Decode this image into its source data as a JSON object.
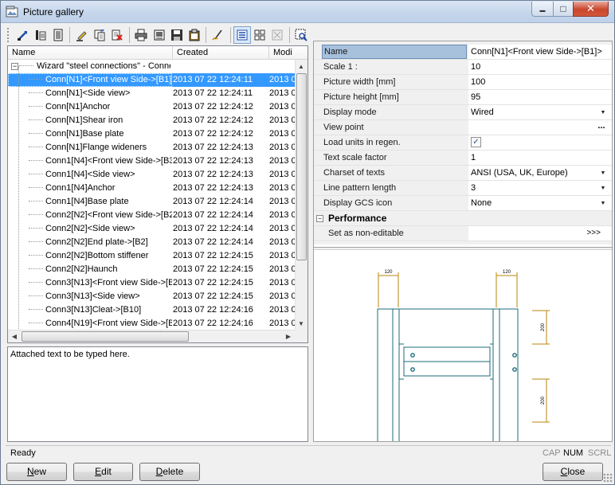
{
  "window": {
    "title": "Picture gallery"
  },
  "toolbar": {
    "buttons": [
      {
        "name": "insert-picture-icon",
        "state": "normal"
      },
      {
        "name": "insert-from-file-icon",
        "state": "normal"
      },
      {
        "name": "properties-icon",
        "state": "normal"
      },
      {
        "name": "rename-icon",
        "state": "normal"
      },
      {
        "name": "copy-picture-icon",
        "state": "normal"
      },
      {
        "name": "delete-picture-icon",
        "state": "normal"
      },
      {
        "name": "print-icon",
        "state": "normal"
      },
      {
        "name": "print-preview-icon",
        "state": "normal"
      },
      {
        "name": "save-icon",
        "state": "normal"
      },
      {
        "name": "clipboard-icon",
        "state": "normal"
      },
      {
        "name": "edit-pen-icon",
        "state": "normal"
      },
      {
        "name": "details-view-icon",
        "state": "active"
      },
      {
        "name": "thumbnails-view-icon",
        "state": "normal"
      },
      {
        "name": "disabled-view-icon",
        "state": "disabled"
      },
      {
        "name": "zoom-preview-icon",
        "state": "normal"
      }
    ]
  },
  "list": {
    "columns": [
      "Name",
      "Created",
      "Modi"
    ],
    "root": "Wizard \"steel connections\" - Conne",
    "rows": [
      {
        "name": "Conn[N1]<Front view Side->[B1]>",
        "created": "2013 07 22 12:24:11",
        "modified": "2013 0",
        "selected": true
      },
      {
        "name": "Conn[N1]<Side view>",
        "created": "2013 07 22 12:24:11",
        "modified": "2013 0"
      },
      {
        "name": "Conn[N1]Anchor",
        "created": "2013 07 22 12:24:12",
        "modified": "2013 0"
      },
      {
        "name": "Conn[N1]Shear iron",
        "created": "2013 07 22 12:24:12",
        "modified": "2013 0"
      },
      {
        "name": "Conn[N1]Base plate",
        "created": "2013 07 22 12:24:12",
        "modified": "2013 0"
      },
      {
        "name": "Conn[N1]Flange wideners",
        "created": "2013 07 22 12:24:13",
        "modified": "2013 0"
      },
      {
        "name": "Conn1[N4]<Front view Side->[B3]:",
        "created": "2013 07 22 12:24:13",
        "modified": "2013 0"
      },
      {
        "name": "Conn1[N4]<Side view>",
        "created": "2013 07 22 12:24:13",
        "modified": "2013 0"
      },
      {
        "name": "Conn1[N4]Anchor",
        "created": "2013 07 22 12:24:13",
        "modified": "2013 0"
      },
      {
        "name": "Conn1[N4]Base plate",
        "created": "2013 07 22 12:24:14",
        "modified": "2013 0"
      },
      {
        "name": "Conn2[N2]<Front view Side->[B2]:",
        "created": "2013 07 22 12:24:14",
        "modified": "2013 0"
      },
      {
        "name": "Conn2[N2]<Side view>",
        "created": "2013 07 22 12:24:14",
        "modified": "2013 0"
      },
      {
        "name": "Conn2[N2]End plate->[B2]",
        "created": "2013 07 22 12:24:14",
        "modified": "2013 0"
      },
      {
        "name": "Conn2[N2]Bottom stiffener",
        "created": "2013 07 22 12:24:15",
        "modified": "2013 0"
      },
      {
        "name": "Conn2[N2]Haunch",
        "created": "2013 07 22 12:24:15",
        "modified": "2013 0"
      },
      {
        "name": "Conn3[N13]<Front view Side->[B1",
        "created": "2013 07 22 12:24:15",
        "modified": "2013 0"
      },
      {
        "name": "Conn3[N13]<Side view>",
        "created": "2013 07 22 12:24:15",
        "modified": "2013 0"
      },
      {
        "name": "Conn3[N13]Cleat->[B10]",
        "created": "2013 07 22 12:24:16",
        "modified": "2013 0"
      },
      {
        "name": "Conn4[N19]<Front view Side->[B1",
        "created": "2013 07 22 12:24:16",
        "modified": "2013 0"
      }
    ]
  },
  "notes": {
    "text": "Attached text to be typed here."
  },
  "properties": {
    "rows": [
      {
        "label": "Name",
        "value": "Conn[N1]<Front view Side->[B1]>",
        "kind": "text",
        "selected": true
      },
      {
        "label": "Scale 1 :",
        "value": "10",
        "kind": "text"
      },
      {
        "label": "Picture width [mm]",
        "value": "100",
        "kind": "text"
      },
      {
        "label": "Picture height [mm]",
        "value": "95",
        "kind": "text"
      },
      {
        "label": "Display mode",
        "value": "Wired",
        "kind": "dropdown"
      },
      {
        "label": "View point",
        "value": "",
        "kind": "ellipsis"
      },
      {
        "label": "Load units in regen.",
        "value": "",
        "kind": "checkbox",
        "checked": true
      },
      {
        "label": "Text scale factor",
        "value": "1",
        "kind": "text"
      },
      {
        "label": "Charset of texts",
        "value": "ANSI (USA, UK, Europe)",
        "kind": "dropdown"
      },
      {
        "label": "Line pattern length",
        "value": "3",
        "kind": "dropdown"
      },
      {
        "label": "Display GCS icon",
        "value": "None",
        "kind": "dropdown"
      }
    ],
    "group": {
      "label": "Performance",
      "toggle": "−"
    },
    "group_rows": [
      {
        "label": "Set as non-editable",
        "value": ">>>"
      }
    ],
    "ellipsis_label": "...",
    "dropdown_glyph": "▼",
    "check_glyph": "✓"
  },
  "preview": {
    "dims": [
      "120",
      "120",
      "200",
      "200"
    ],
    "line_color": "#1b6b7a",
    "dim_color": "#b8860b"
  },
  "status": {
    "text": "Ready",
    "indicators": [
      {
        "label": "CAP",
        "on": false
      },
      {
        "label": "NUM",
        "on": true
      },
      {
        "label": "SCRL",
        "on": false
      }
    ]
  },
  "buttons": {
    "new": {
      "label": "New",
      "hotkey": "N",
      "rest": "ew"
    },
    "edit": {
      "label": "Edit",
      "hotkey": "E",
      "rest": "dit"
    },
    "delete": {
      "label": "Delete",
      "hotkey": "D",
      "rest": "elete"
    },
    "close": {
      "label": "Close",
      "hotkey": "C",
      "rest": "lose"
    }
  },
  "titlebar_buttons": {
    "min": "▬",
    "max": "□",
    "close": "✕"
  }
}
